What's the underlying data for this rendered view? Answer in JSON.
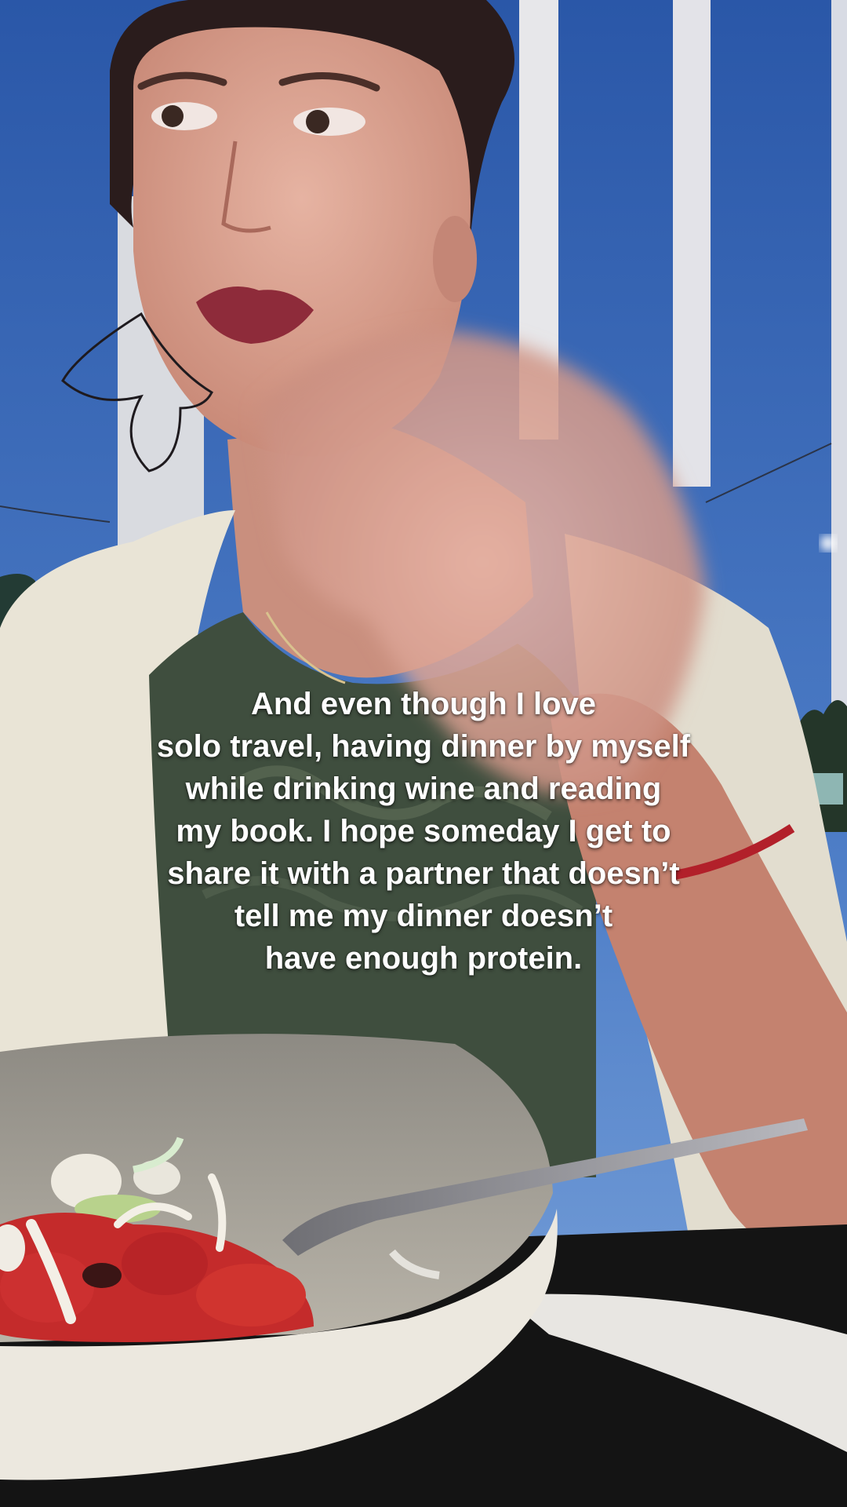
{
  "caption": {
    "lines": [
      "And even though I love",
      "solo travel, having dinner by myself",
      "while drinking wine and reading",
      "my book. I hope someday I get to",
      "share it with a partner that doesn’t",
      "tell me my dinner doesn’t",
      "have enough protein."
    ]
  },
  "colors": {
    "sky_top": "#2f5fb0",
    "sky_bottom": "#6d9bd8",
    "skin": "#d9a08f",
    "lips": "#8e2b3a",
    "hair": "#2a1c1c",
    "cardigan": "#e9e4d6",
    "top": "#3f4e3e",
    "bowl": "#ece8df",
    "tomato": "#c42b2b",
    "table": "#141414",
    "caption_text": "#ffffff"
  }
}
